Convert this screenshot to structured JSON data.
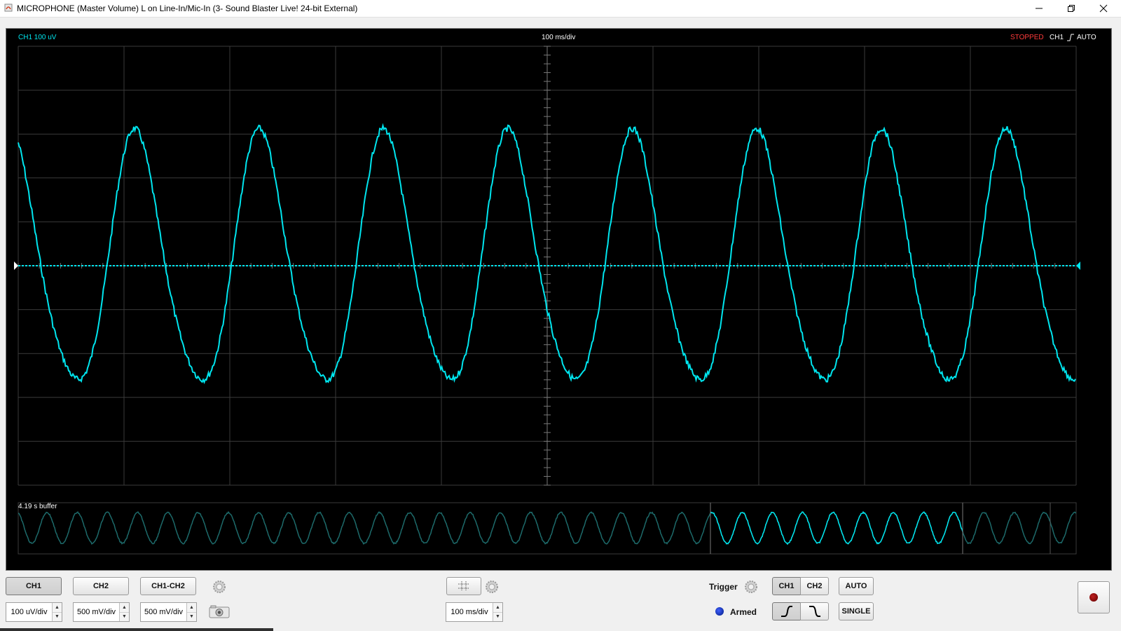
{
  "window": {
    "title": "MICROPHONE (Master Volume) L on Line-In/Mic-In (3- Sound Blaster Live! 24-bit External)",
    "controls": [
      "minimize-icon",
      "restore-icon",
      "close-icon"
    ]
  },
  "scope": {
    "ch1_scale": "CH1 100 uV",
    "timebase": "100 ms/div",
    "status": "STOPPED",
    "trigger_channel": "CH1",
    "trigger_edge_icon": "rising-edge-icon",
    "trigger_mode": "AUTO",
    "buffer_label": "4.19 s buffer",
    "trace_color": "#00e5ee",
    "grid_color": "#3a3a3a",
    "waveform": {
      "cycles_on_screen": 8.5,
      "amplitude_divisions": 3,
      "phase_cycles": 0.05,
      "buffer_cycles": 35
    }
  },
  "controls": {
    "ch1_label": "CH1",
    "ch2_label": "CH2",
    "ch1_minus_ch2_label": "CH1-CH2",
    "ch1_volts": "100 uV/div",
    "ch2_volts": "500 mV/div",
    "math_volts": "500 mV/div",
    "timebase_value": "100 ms/div",
    "trigger_label": "Trigger",
    "trigger_ch1": "CH1",
    "trigger_ch2": "CH2",
    "auto_label": "AUTO",
    "single_label": "SINGLE",
    "armed_label": "Armed",
    "armed_color": "#0a2aa0",
    "record_color": "#8b0000"
  }
}
